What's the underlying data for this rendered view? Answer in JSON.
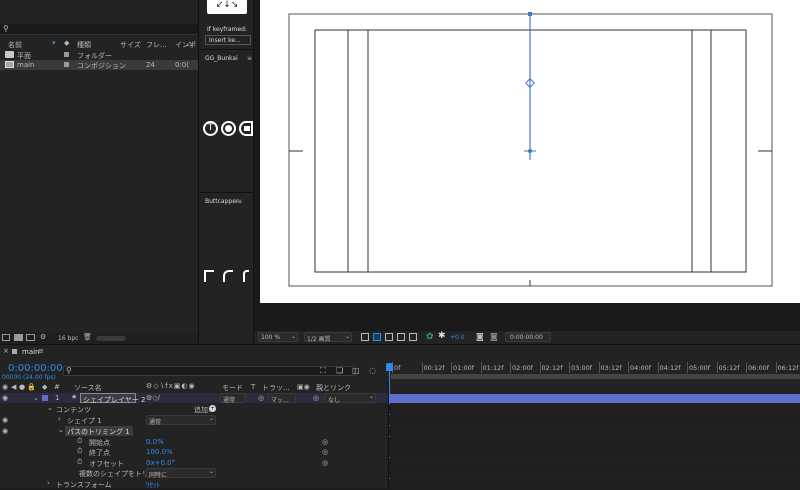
{
  "colors": {
    "accent": "#2d8ceb",
    "layer_bar": "#5f6fce",
    "guide": "#4a74c8",
    "panel_bg": "#232323",
    "canvas": "#ffffff"
  },
  "project": {
    "search_icon": "search-icon",
    "headers": {
      "name": "名前",
      "label": "種類",
      "size": "サイズ",
      "frame": "フレ...",
      "in": "インポ"
    },
    "rows": [
      {
        "name": "平面",
        "type": "フォルダー",
        "size": "",
        "frame": "",
        "in": ""
      },
      {
        "name": "main",
        "type": "コンポジション",
        "size": "",
        "frame": "24",
        "in": "0:0("
      }
    ],
    "bpc": "16 bpc"
  },
  "plugins": {
    "if_keyframed": "If keyframed:",
    "insert_key": "Insert ke...",
    "gg_title": "GG_Bunkai",
    "buttcapper_title": "Buttcapper"
  },
  "viewer": {
    "zoom": "100 %",
    "resolution": "1/2 画質",
    "exposure": "+0.0",
    "timecode": "0:00:00:00"
  },
  "timeline": {
    "tab_label": "main",
    "timecode": "0:00:00:00",
    "fps": "00000 (24.00 fps)",
    "col_source": "ソース名",
    "col_mode": "モード",
    "col_t": "T",
    "col_track": "トラッ...",
    "col_parent": "親とリンク",
    "layer_index": "1",
    "layer_name": "シェイプレイヤー 2",
    "layer_mode": "通常",
    "layer_matte": "マッ...",
    "layer_parent": "なし",
    "contents_label": "コンテンツ",
    "add_label": "追加:",
    "shape1_label": "シェイプ 1",
    "shape1_mode": "通常",
    "trim_label": "パスのトリミング 1",
    "start_label": "開始点",
    "start_value": "0.0%",
    "end_label": "終了点",
    "end_value": "100.0%",
    "offset_label": "オフセット",
    "offset_value": "0x+0.0°",
    "multi_label": "複数のシェイプをトリム",
    "multi_value": "同時に",
    "transform_label": "トランスフォーム",
    "reset_label": "ﾘｾｯﾄ",
    "ruler": [
      "0f",
      "00:12f",
      "01:00f",
      "01:12f",
      "02:00f",
      "02:12f",
      "03:00f",
      "03:12f",
      "04:00f",
      "04:12f",
      "05:00f",
      "05:12f",
      "06:00f",
      "06:12f"
    ]
  }
}
